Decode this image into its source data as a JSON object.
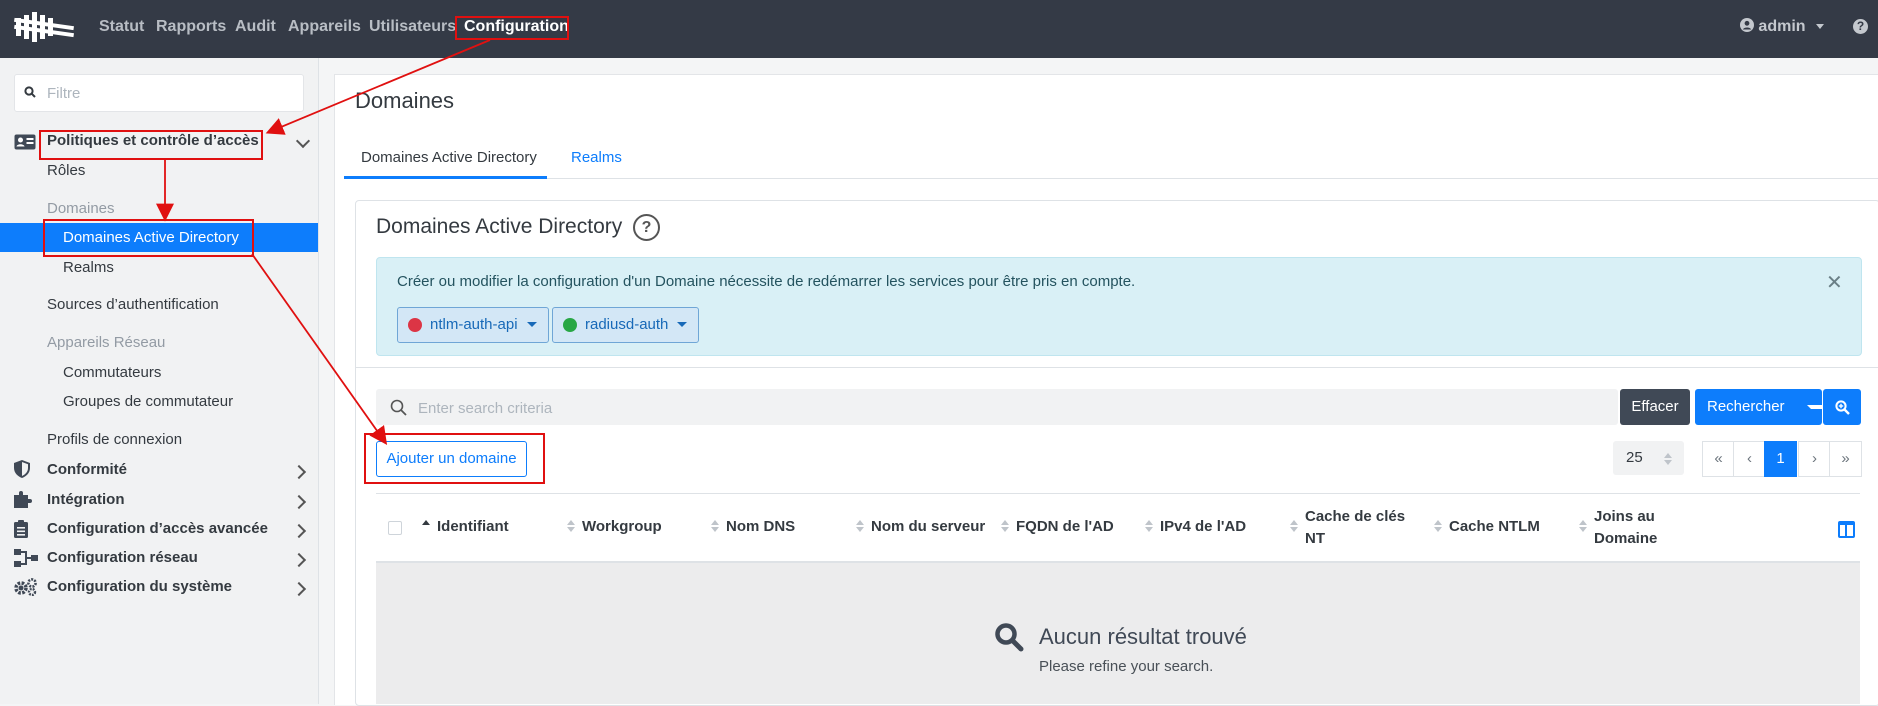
{
  "nav": {
    "items": [
      "Statut",
      "Rapports",
      "Audit",
      "Appareils",
      "Utilisateurs",
      "Configuration"
    ],
    "user": "admin",
    "help": "?"
  },
  "sidebar": {
    "filter_placeholder": "Filtre",
    "section_policies": "Politiques et contrôle d’accès",
    "roles": "Rôles",
    "domains_group": "Domaines",
    "ad_domains": "Domaines Active Directory",
    "realms": "Realms",
    "auth_sources": "Sources d’authentification",
    "network_devices_group": "Appareils Réseau",
    "switches": "Commutateurs",
    "switch_groups": "Groupes de commutateur",
    "connection_profiles": "Profils de connexion",
    "compliance": "Conformité",
    "integration": "Intégration",
    "advanced_access": "Configuration d’accès avancée",
    "network_config": "Configuration réseau",
    "system_config": "Configuration du système"
  },
  "main": {
    "page_title": "Domaines",
    "tabs": [
      "Domaines Active Directory",
      "Realms"
    ],
    "card_title": "Domaines Active Directory",
    "alert_text": "Créer ou modifier la configuration d'un Domaine nécessite de redémarrer les services pour être pris en compte.",
    "services": [
      {
        "name": "ntlm-auth-api",
        "color": "#dc3545"
      },
      {
        "name": "radiusd-auth",
        "color": "#28a745"
      }
    ],
    "search_placeholder": "Enter search criteria",
    "btn_clear": "Effacer",
    "btn_search": "Rechercher",
    "btn_add": "Ajouter un domaine",
    "per_page": "25",
    "pager": [
      "«",
      "‹",
      "1",
      "›",
      "»"
    ],
    "columns": [
      "Identifiant",
      "Workgroup",
      "Nom DNS",
      "Nom du serveur",
      "FQDN de l'AD",
      "IPv4 de l'AD",
      "Cache de clés NT",
      "Cache NTLM",
      "Joins au Domaine"
    ],
    "empty_title": "Aucun résultat trouvé",
    "empty_sub": "Please refine your search."
  },
  "colors": {
    "accent": "#0d7dfc",
    "annotation": "#e01010",
    "topbar": "#343a46"
  }
}
